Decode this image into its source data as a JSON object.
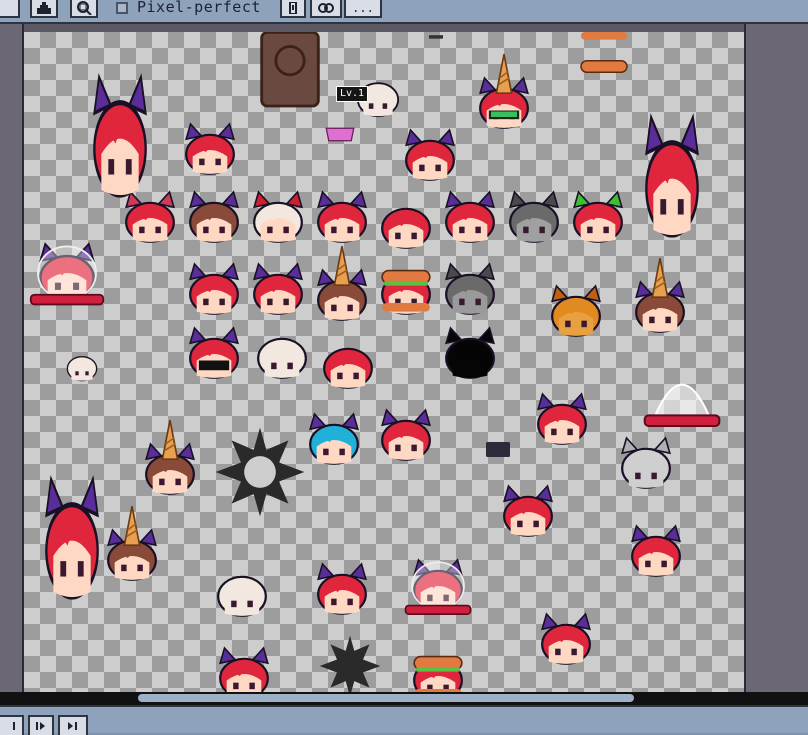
{
  "toolbar": {
    "pixel_perfect_label": "Pixel-perfect",
    "more_label": "...",
    "pixel_perfect_checked": false
  },
  "canvas": {
    "level_tag": "Lv.1",
    "checker_colors": [
      "#cdcdcd",
      "#9d9d9d"
    ]
  },
  "playback": {
    "buttons": [
      "skip-back",
      "next-frame",
      "skip-end"
    ]
  },
  "colors": {
    "hair_red": "#e0263d",
    "bow_purple": "#5a2e9a",
    "skin": "#ffd8c4",
    "workspace": "#5c5864",
    "ui_panel": "#8ea2bc"
  }
}
